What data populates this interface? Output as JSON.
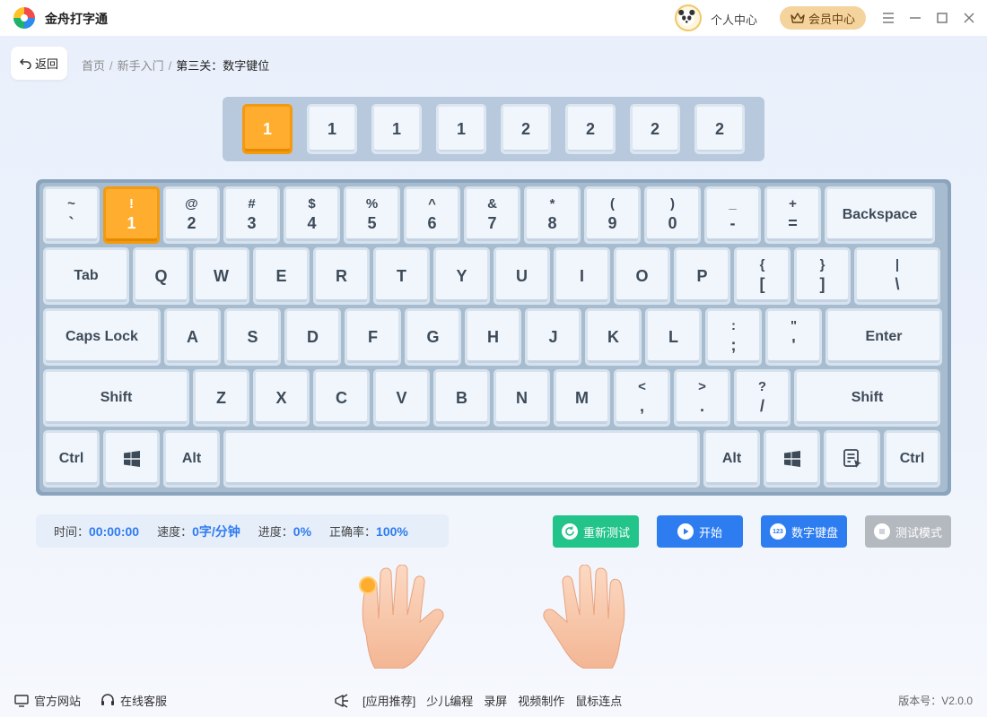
{
  "app": {
    "title": "金舟打字通"
  },
  "header": {
    "personal_center": "个人中心",
    "vip_center": "会员中心"
  },
  "nav": {
    "back_label": "返回",
    "breadcrumb": [
      "首页",
      "新手入门",
      "第三关：数字键位"
    ]
  },
  "sequence": {
    "keys": [
      "1",
      "1",
      "1",
      "1",
      "2",
      "2",
      "2",
      "2"
    ],
    "active_index": 0
  },
  "keyboard": {
    "active_key": "1",
    "rows": [
      [
        [
          "~",
          "`"
        ],
        [
          "!",
          "1"
        ],
        [
          "@",
          "2"
        ],
        [
          "#",
          "3"
        ],
        [
          "$",
          "4"
        ],
        [
          "%",
          "5"
        ],
        [
          "^",
          "6"
        ],
        [
          "&",
          "7"
        ],
        [
          "*",
          "8"
        ],
        [
          "(",
          "9"
        ],
        [
          ")",
          "0"
        ],
        [
          "_",
          "-"
        ],
        [
          "+",
          "="
        ],
        [
          "Backspace"
        ]
      ],
      [
        [
          "Tab"
        ],
        [
          "Q"
        ],
        [
          "W"
        ],
        [
          "E"
        ],
        [
          "R"
        ],
        [
          "T"
        ],
        [
          "Y"
        ],
        [
          "U"
        ],
        [
          "I"
        ],
        [
          "O"
        ],
        [
          "P"
        ],
        [
          "{",
          "["
        ],
        [
          "}",
          "]"
        ],
        [
          "|",
          "\\"
        ]
      ],
      [
        [
          "Caps Lock"
        ],
        [
          "A"
        ],
        [
          "S"
        ],
        [
          "D"
        ],
        [
          "F"
        ],
        [
          "G"
        ],
        [
          "H"
        ],
        [
          "J"
        ],
        [
          "K"
        ],
        [
          "L"
        ],
        [
          ":",
          ";"
        ],
        [
          "\"",
          "'"
        ],
        [
          "Enter"
        ]
      ],
      [
        [
          "Shift"
        ],
        [
          "Z"
        ],
        [
          "X"
        ],
        [
          "C"
        ],
        [
          "V"
        ],
        [
          "B"
        ],
        [
          "N"
        ],
        [
          "M"
        ],
        [
          "<",
          ","
        ],
        [
          ">",
          "."
        ],
        [
          "?",
          "/"
        ],
        [
          "Shift"
        ]
      ],
      [
        [
          "Ctrl"
        ],
        [
          "windows-icon"
        ],
        [
          "Alt"
        ],
        [
          ""
        ],
        [
          "Alt"
        ],
        [
          "windows-icon"
        ],
        [
          "menu-icon"
        ],
        [
          "Ctrl"
        ]
      ]
    ]
  },
  "stats": {
    "time_label": "时间：",
    "time_value": "00:00:00",
    "speed_label": "速度：",
    "speed_value": "0字/分钟",
    "progress_label": "进度：",
    "progress_value": "0%",
    "accuracy_label": "正确率：",
    "accuracy_value": "100%"
  },
  "actions": {
    "retest": "重新测试",
    "start": "开始",
    "numpad": "数字键盘",
    "numpad_icon": "123",
    "test_mode": "测试模式"
  },
  "footer": {
    "official_site": "官方网站",
    "online_service": "在线客服",
    "recommend": "[应用推荐]",
    "links": [
      "少儿编程",
      "录屏",
      "视频制作",
      "鼠标连点"
    ],
    "version": "版本号：V2.0.0"
  },
  "colors": {
    "accent_orange": "#ffad2e",
    "blue": "#2e7df0",
    "green": "#22c489",
    "gray": "#b4b9c0",
    "vip_gold": "#f4d39d"
  }
}
